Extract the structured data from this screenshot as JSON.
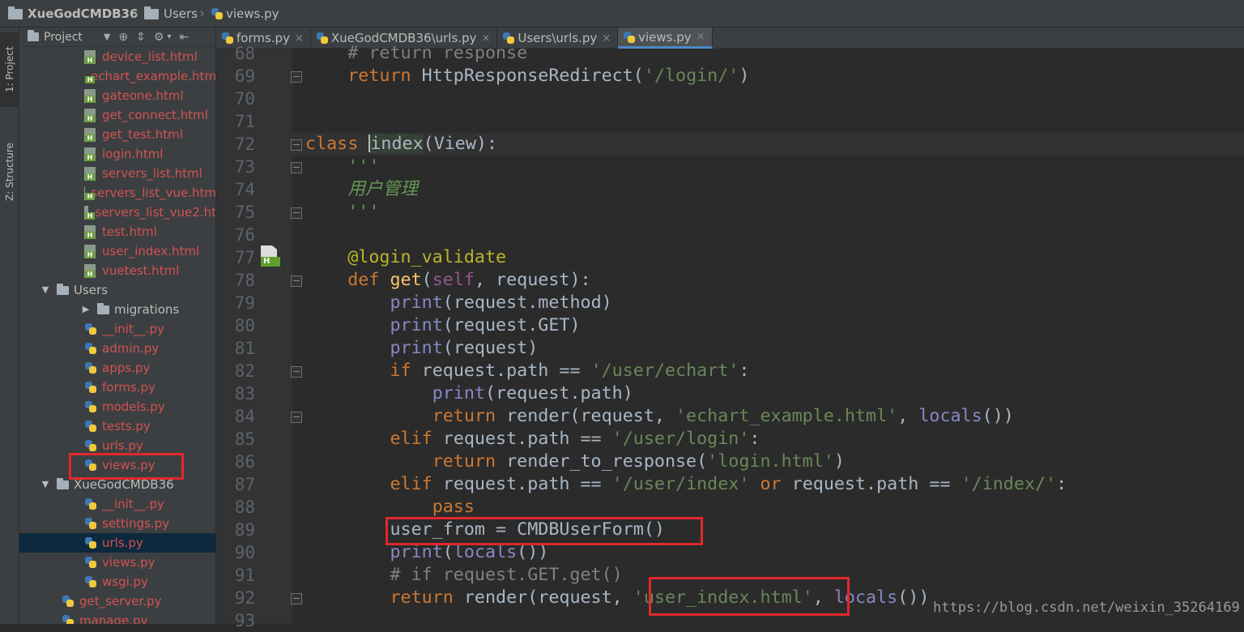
{
  "breadcrumb": {
    "project": "XueGodCMDB36",
    "folder": "Users",
    "file": "views.py"
  },
  "side_tabs": {
    "project": "1: Project",
    "structure": "Z: Structure"
  },
  "project_panel": {
    "title": "Project",
    "tree": [
      {
        "label": "device_list.html",
        "kind": "html",
        "indent": 1
      },
      {
        "label": "echart_example.htm",
        "kind": "html",
        "indent": 1
      },
      {
        "label": "gateone.html",
        "kind": "html",
        "indent": 1
      },
      {
        "label": "get_connect.html",
        "kind": "html",
        "indent": 1
      },
      {
        "label": "get_test.html",
        "kind": "html",
        "indent": 1
      },
      {
        "label": "login.html",
        "kind": "html",
        "indent": 1
      },
      {
        "label": "servers_list.html",
        "kind": "html",
        "indent": 1
      },
      {
        "label": "servers_list_vue.htm",
        "kind": "html",
        "indent": 1
      },
      {
        "label": "servers_list_vue2.ht",
        "kind": "html",
        "indent": 1
      },
      {
        "label": "test.html",
        "kind": "html",
        "indent": 1
      },
      {
        "label": "user_index.html",
        "kind": "html",
        "indent": 1
      },
      {
        "label": "vuetest.html",
        "kind": "html",
        "indent": 1
      },
      {
        "label": "Users",
        "kind": "folder-open",
        "indent": 0
      },
      {
        "label": "migrations",
        "kind": "folder-closed",
        "indent": 1
      },
      {
        "label": "__init__.py",
        "kind": "py",
        "indent": 1
      },
      {
        "label": "admin.py",
        "kind": "py",
        "indent": 1
      },
      {
        "label": "apps.py",
        "kind": "py",
        "indent": 1
      },
      {
        "label": "forms.py",
        "kind": "py",
        "indent": 1
      },
      {
        "label": "models.py",
        "kind": "py",
        "indent": 1
      },
      {
        "label": "tests.py",
        "kind": "py",
        "indent": 1
      },
      {
        "label": "urls.py",
        "kind": "py",
        "indent": 1
      },
      {
        "label": "views.py",
        "kind": "py",
        "indent": 1
      },
      {
        "label": "XueGodCMDB36",
        "kind": "folder-open",
        "indent": 0
      },
      {
        "label": "__init__.py",
        "kind": "py",
        "indent": 1
      },
      {
        "label": "settings.py",
        "kind": "py",
        "indent": 1
      },
      {
        "label": "urls.py",
        "kind": "py",
        "indent": 1,
        "selected": true
      },
      {
        "label": "views.py",
        "kind": "py",
        "indent": 1
      },
      {
        "label": "wsgi.py",
        "kind": "py",
        "indent": 1
      },
      {
        "label": "get_server.py",
        "kind": "py",
        "indent": -1
      },
      {
        "label": "manage.py",
        "kind": "py",
        "indent": -1
      }
    ]
  },
  "tabs": [
    {
      "label": "forms.py",
      "active": false
    },
    {
      "label": "XueGodCMDB36\\urls.py",
      "active": false
    },
    {
      "label": "Users\\urls.py",
      "active": false
    },
    {
      "label": "views.py",
      "active": true
    }
  ],
  "line_numbers": [
    "68",
    "69",
    "70",
    "71",
    "72",
    "73",
    "74",
    "75",
    "76",
    "77",
    "78",
    "79",
    "80",
    "81",
    "82",
    "83",
    "84",
    "85",
    "86",
    "87",
    "88",
    "89",
    "90",
    "91",
    "92",
    "93"
  ],
  "code": {
    "l68": "    # return response",
    "l69_kw": "    return",
    "l69_rest": " HttpResponseRedirect(",
    "l69_str": "'/login/'",
    "l69_end": ")",
    "l72_kw": "class ",
    "l72_name": "index",
    "l72_rest": "(View):",
    "l73": "    '''",
    "l74": "    用户管理",
    "l75": "    '''",
    "l77": "    @login_validate",
    "l78_kw": "    def ",
    "l78_fn": "get",
    "l78_a": "(",
    "l78_self": "self",
    "l78_b": ", request):",
    "print": "print",
    "l79_rest": "(request.method)",
    "l80_rest": "(request.GET)",
    "l81_rest": "(request)",
    "if": "if",
    "l82_a": " request.path == ",
    "l82_str": "'/user/echart'",
    "colon": ":",
    "return": "return",
    "l83_rest": "(request.path)",
    "l84_a": " render(request, ",
    "l84_str": "'echart_example.html'",
    "l84_b": ", ",
    "locals": "locals",
    "l84_c": "())",
    "elif": "elif",
    "l85_str": "'/user/login'",
    "l86_a": " render_to_response(",
    "l86_str": "'login.html'",
    "l86_b": ")",
    "l87_str": "'/user/index'",
    "or": " or",
    "l87_b": " request.path == ",
    "l87_str2": "'/index/'",
    "pass": "pass",
    "l89": "user_from = CMDBUserForm()",
    "l90_a": "(",
    "l90_b": "())",
    "l91": "# if request.GET.get()",
    "l92_str": "'user_index.html'"
  },
  "watermark": "https://blog.csdn.net/weixin_35264169"
}
